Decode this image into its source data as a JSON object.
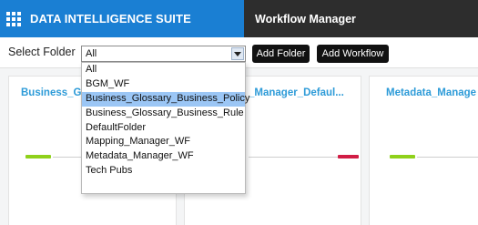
{
  "header": {
    "app_title": "DATA INTELLIGENCE SUITE",
    "module_title": "Workflow Manager",
    "apps_icon": "grid-icon"
  },
  "toolbar": {
    "folder_label": "Select Folder",
    "selected_folder": "All",
    "add_folder_label": "Add Folder",
    "add_workflow_label": "Add Workflow"
  },
  "dropdown": {
    "highlighted": "Business_Glossary_Business_Policy",
    "options": [
      "All",
      "BGM_WF",
      "Business_Glossary_Business_Policy",
      "Business_Glossary_Business_Rule",
      "DefaultFolder",
      "Mapping_Manager_WF",
      "Metadata_Manager_WF",
      "Tech Pubs"
    ]
  },
  "cards": [
    {
      "title": "Business_Glo",
      "node_color": "#8fd11b"
    },
    {
      "title": "_Manager_Defaul...",
      "node_color": "#d11d45"
    },
    {
      "title": "Metadata_Manage",
      "node_color": "#8fd11b"
    }
  ],
  "colors": {
    "brand": "#1a7fd3",
    "module_bar": "#2d2d2d",
    "card_title": "#2d9bd8",
    "highlight": "#9bc6f5"
  }
}
